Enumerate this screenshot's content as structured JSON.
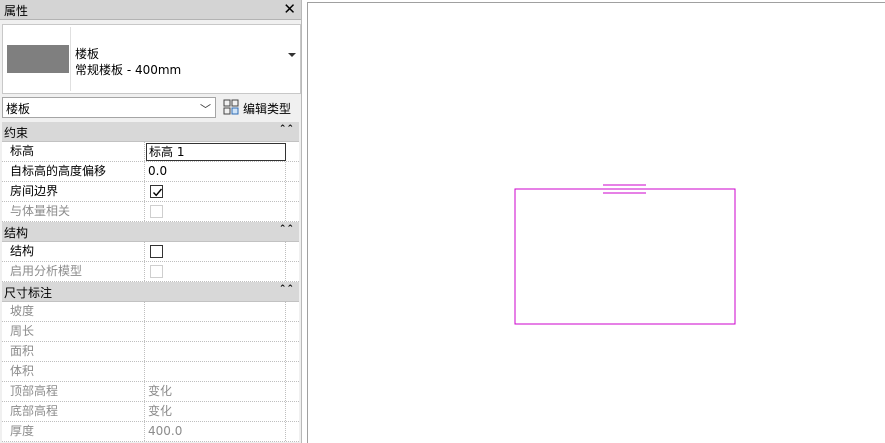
{
  "palette": {
    "title": "属性",
    "close_glyph": "✕",
    "type_selector": {
      "family": "楼板",
      "type_name": "常规楼板 - 400mm",
      "swatch_color": "#7f7f7f"
    },
    "instance_filter": {
      "value": "楼板",
      "edit_type_label": "编辑类型"
    },
    "groups": [
      {
        "label": "约束",
        "rows": [
          {
            "name": "标高",
            "value": "标高 1"
          },
          {
            "name": "自标高的高度偏移",
            "value": "0.0"
          },
          {
            "name": "房间边界",
            "checkbox": true
          },
          {
            "name": "与体量相关",
            "checkbox": false
          }
        ]
      },
      {
        "label": "结构",
        "rows": [
          {
            "name": "结构",
            "checkbox": false
          },
          {
            "name": "启用分析模型",
            "checkbox": false
          }
        ]
      },
      {
        "label": "尺寸标注",
        "rows": [
          {
            "name": "坡度",
            "value": ""
          },
          {
            "name": "周长",
            "value": ""
          },
          {
            "name": "面积",
            "value": ""
          },
          {
            "name": "体积",
            "value": ""
          },
          {
            "name": "顶部高程",
            "value": "变化"
          },
          {
            "name": "底部高程",
            "value": "变化"
          },
          {
            "name": "厚度",
            "value": "400.0"
          }
        ]
      }
    ]
  },
  "canvas": {
    "sketch_color": "#cc00cc",
    "marker_color": "#cc00cc"
  }
}
